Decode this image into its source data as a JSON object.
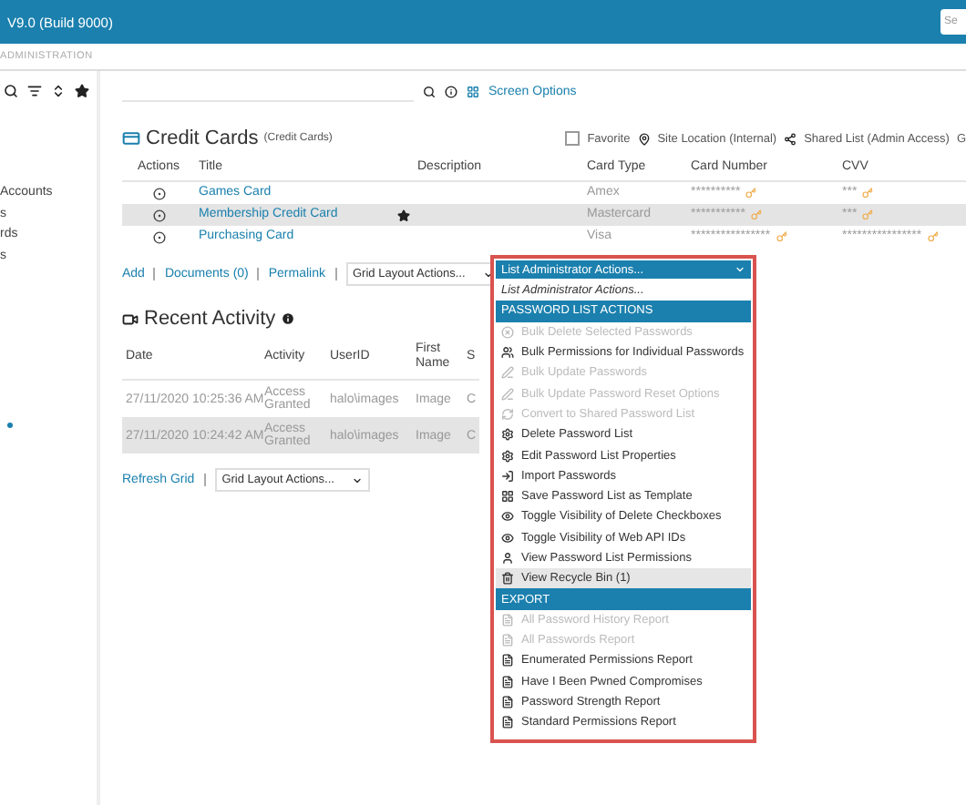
{
  "top_bar": {
    "version": "V9.0 (Build 9000)",
    "search_placeholder": "Se"
  },
  "breadcrumb": "ADMINISTRATION",
  "sidebar": {
    "items": [
      "Accounts",
      "s",
      "rds",
      "s"
    ]
  },
  "toolbar": {
    "screen_options": "Screen Options"
  },
  "credit_cards": {
    "title": "Credit Cards",
    "subtitle": "(Credit Cards)",
    "favorite": {
      "label": "Favorite",
      "checked": false
    },
    "site_location": "Site Location (Internal)",
    "shared_list": "Shared List (Admin Access)",
    "more": "G",
    "columns": [
      "Actions",
      "Title",
      "Description",
      "Card Type",
      "Card Number",
      "CVV"
    ],
    "rows": [
      {
        "title": "Games Card",
        "card_type": "Amex",
        "card_number": "**********",
        "cvv": "***",
        "starred": false,
        "selected": false
      },
      {
        "title": "Membership Credit Card",
        "card_type": "Mastercard",
        "card_number": "***********",
        "cvv": "***",
        "starred": true,
        "selected": true
      },
      {
        "title": "Purchasing Card",
        "card_type": "Visa",
        "card_number": "****************",
        "cvv": "****************",
        "starred": false,
        "selected": false
      }
    ],
    "links": [
      "Add",
      "Documents (0)",
      "Permalink"
    ],
    "grid_select": "Grid Layout Actions...",
    "admin_select": "List Administrator Actions..."
  },
  "recent_activity": {
    "title": "Recent Activity",
    "columns": [
      "Date",
      "Activity",
      "UserID",
      "First Name",
      "S"
    ],
    "rows": [
      {
        "date": "27/11/2020 10:25:36 AM",
        "activity": "Access Granted",
        "user": "halo\\images",
        "first_name": "Image",
        "column_5": "C",
        "selected": false
      },
      {
        "date": "27/11/2020 10:24:42 AM",
        "activity": "Access Granted",
        "user": "halo\\images",
        "first_name": "Image",
        "column_5": "C",
        "selected": true
      }
    ],
    "refresh": "Refresh Grid",
    "grid_select": "Grid Layout Actions..."
  },
  "menu": {
    "items": [
      {
        "kind": "placeholder",
        "label": "List Administrator Actions..."
      },
      {
        "kind": "section",
        "label": "PASSWORD LIST ACTIONS"
      },
      {
        "kind": "item",
        "label": "Bulk Delete Selected Passwords",
        "disabled": true,
        "selected": false
      },
      {
        "kind": "item",
        "label": "Bulk Permissions for Individual Passwords",
        "disabled": false,
        "selected": false
      },
      {
        "kind": "item",
        "label": "Bulk Update Passwords",
        "disabled": true,
        "selected": false
      },
      {
        "kind": "item",
        "label": "Bulk Update Password Reset Options",
        "disabled": true,
        "selected": false
      },
      {
        "kind": "item",
        "label": "Convert to Shared Password List",
        "disabled": true,
        "selected": false
      },
      {
        "kind": "item",
        "label": "Delete Password List",
        "disabled": false,
        "selected": false
      },
      {
        "kind": "item",
        "label": "Edit Password List Properties",
        "disabled": false,
        "selected": false
      },
      {
        "kind": "item",
        "label": "Import Passwords",
        "disabled": false,
        "selected": false
      },
      {
        "kind": "item",
        "label": "Save Password List as Template",
        "disabled": false,
        "selected": false
      },
      {
        "kind": "item",
        "label": "Toggle Visibility of Delete Checkboxes",
        "disabled": false,
        "selected": false
      },
      {
        "kind": "item",
        "label": "Toggle Visibility of Web API IDs",
        "disabled": false,
        "selected": false
      },
      {
        "kind": "item",
        "label": "View Password List Permissions",
        "disabled": false,
        "selected": false
      },
      {
        "kind": "item",
        "label": "View Recycle Bin (1)",
        "disabled": false,
        "selected": true
      },
      {
        "kind": "section",
        "label": "EXPORT"
      },
      {
        "kind": "report",
        "label": "All Password History Report",
        "disabled": true,
        "selected": false
      },
      {
        "kind": "report",
        "label": "All Passwords Report",
        "disabled": true,
        "selected": false
      },
      {
        "kind": "report",
        "label": "Enumerated Permissions Report",
        "disabled": false,
        "selected": false
      },
      {
        "kind": "report",
        "label": "Have I Been Pwned Compromises",
        "disabled": false,
        "selected": false
      },
      {
        "kind": "report",
        "label": "Password Strength Report",
        "disabled": false,
        "selected": false
      },
      {
        "kind": "report",
        "label": "Standard Permissions Report",
        "disabled": false,
        "selected": false
      }
    ]
  }
}
